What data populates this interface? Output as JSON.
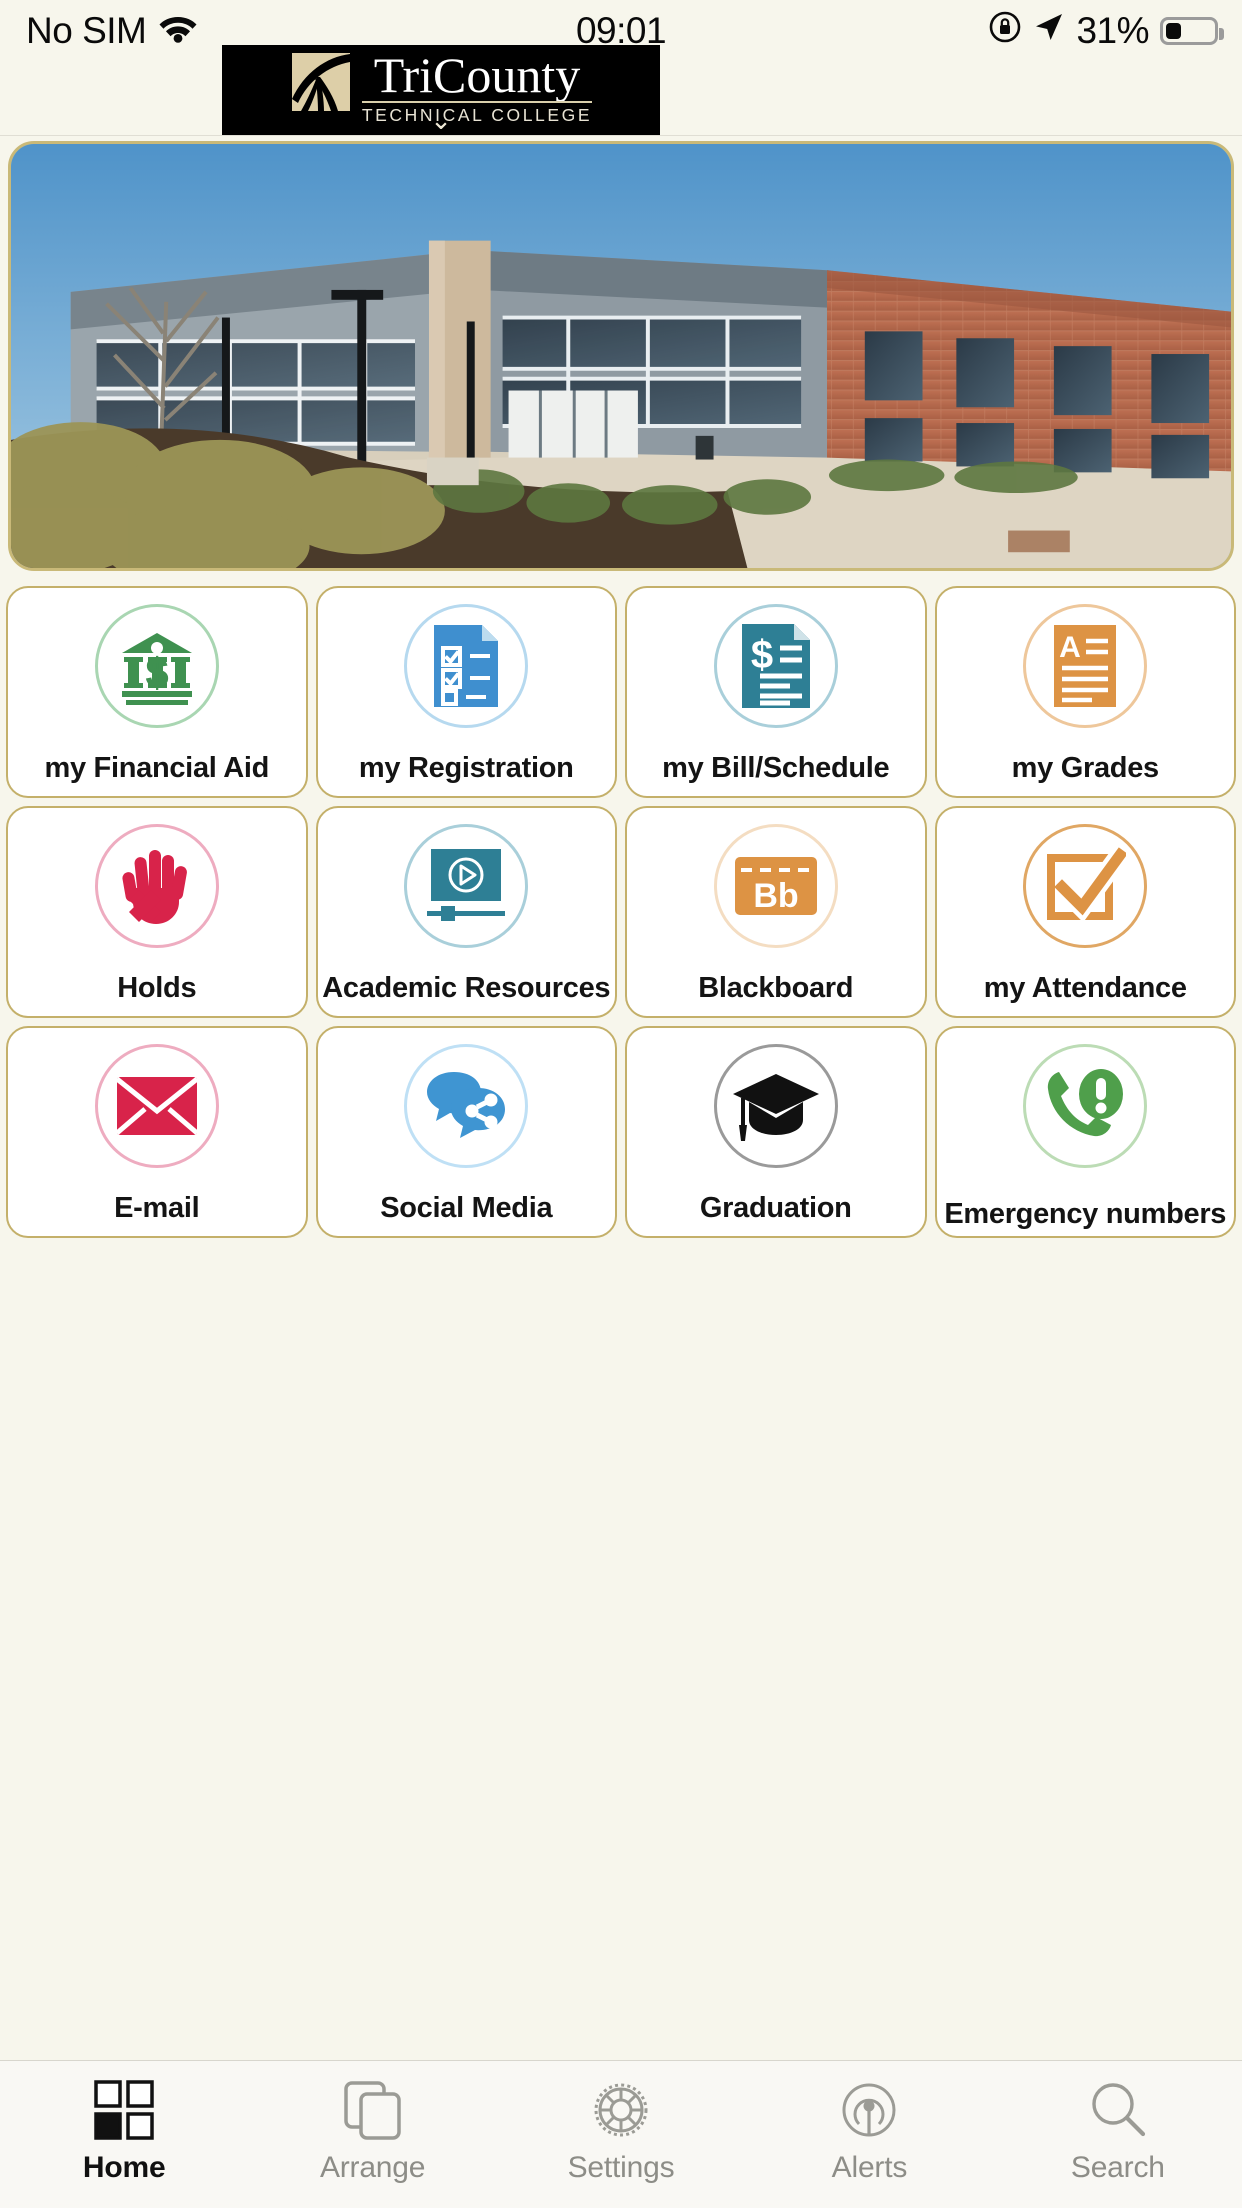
{
  "status_bar": {
    "carrier": "No SIM",
    "wifi_icon": "wifi-icon",
    "time": "09:01",
    "rotation_lock_icon": "rotation-lock-icon",
    "location_icon": "location-arrow-icon",
    "battery_percent": "31%",
    "battery_icon": "battery-icon",
    "battery_level": 31
  },
  "header": {
    "logo_title": "TriCounty",
    "logo_subtitle": "TECHNICAL COLLEGE",
    "logo_mark_icon": "tricounty-swoosh-icon",
    "expand_chevron_icon": "chevron-down-icon"
  },
  "hero": {
    "image_name": "campus-building-photo",
    "alt": "Tri-County Technical College campus building"
  },
  "tiles": [
    {
      "label": "my Financial Aid",
      "icon": "bank-dollar-icon",
      "icon_color": "#3f9150",
      "ring_color": "#a9d6b2"
    },
    {
      "label": "my Registration",
      "icon": "checklist-document-icon",
      "icon_color": "#3f8fcf",
      "ring_color": "#b6d9ef"
    },
    {
      "label": "my Bill/Schedule",
      "icon": "invoice-dollar-icon",
      "icon_color": "#2e7f95",
      "ring_color": "#a9cfda"
    },
    {
      "label": "my Grades",
      "icon": "grade-report-icon",
      "icon_color": "#dd9344",
      "ring_color": "#eec79b"
    },
    {
      "label": "Holds",
      "icon": "stop-hand-icon",
      "icon_color": "#d8234a",
      "ring_color": "#eeacc0"
    },
    {
      "label": "Academic Resources",
      "icon": "video-player-icon",
      "icon_color": "#2e7f95",
      "ring_color": "#a9cfda"
    },
    {
      "label": "Blackboard",
      "icon": "blackboard-bb-icon",
      "icon_color": "#dd9344",
      "ring_color": "#f4ddc2"
    },
    {
      "label": "my Attendance",
      "icon": "checkbox-checked-icon",
      "icon_color": "#dd9344",
      "ring_color": "#e0a764"
    },
    {
      "label": "E-mail",
      "icon": "envelope-icon",
      "icon_color": "#d8234a",
      "ring_color": "#eeacc0"
    },
    {
      "label": "Social Media",
      "icon": "share-chat-bubbles-icon",
      "icon_color": "#3f95d2",
      "ring_color": "#bfe0f5"
    },
    {
      "label": "Graduation",
      "icon": "graduation-cap-icon",
      "icon_color": "#111111",
      "ring_color": "#9a9a9a"
    },
    {
      "label": "Emergency numbers",
      "icon": "emergency-phone-icon",
      "icon_color": "#4f9f4b",
      "ring_color": "#bcdcb5"
    }
  ],
  "tab_bar": {
    "items": [
      {
        "label": "Home",
        "icon": "grid-squares-icon",
        "active": true
      },
      {
        "label": "Arrange",
        "icon": "stacked-pages-icon",
        "active": false
      },
      {
        "label": "Settings",
        "icon": "gear-icon",
        "active": false
      },
      {
        "label": "Alerts",
        "icon": "broadcast-signal-icon",
        "active": false
      },
      {
        "label": "Search",
        "icon": "magnifier-icon",
        "active": false
      }
    ]
  },
  "colors": {
    "page_background": "#f7f6ec",
    "tile_border": "#c4b06a",
    "tile_background": "#ffffff",
    "banner_background": "#000000",
    "tab_inactive": "#8d8d87",
    "tab_active": "#111111"
  }
}
